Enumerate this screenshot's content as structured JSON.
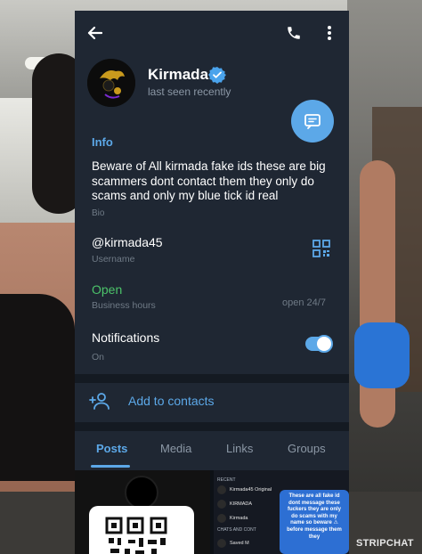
{
  "profile": {
    "name": "Kirmada",
    "status": "last seen recently"
  },
  "info": {
    "section_title": "Info",
    "bio_text": "Beware of All kirmada fake ids these are big scammers dont contact them they only do scams and only my blue tick id real",
    "bio_label": "Bio",
    "username": "@kirmada45",
    "username_label": "Username",
    "business_status": "Open",
    "business_label": "Business hours",
    "business_hours": "open 24/7",
    "notifications_title": "Notifications",
    "notifications_state": "On"
  },
  "actions": {
    "add_contact": "Add to contacts"
  },
  "tabs": [
    {
      "label": "Posts",
      "active": true
    },
    {
      "label": "Media",
      "active": false
    },
    {
      "label": "Links",
      "active": false
    },
    {
      "label": "Groups",
      "active": false
    }
  ],
  "post_preview": {
    "header": "RECENT",
    "rows": [
      "Kirmada45 Original",
      "KIRMADA",
      "Kirmada"
    ],
    "section": "CHATS AND CONT",
    "saved": "Saved M",
    "bubble_text": "These are all fake id dont message these fuckers they are only do scams with my name so beware ⚠ before message them they"
  },
  "watermark": "STRIPCHAT",
  "colors": {
    "panel_bg": "#1f2733",
    "accent": "#5ca8e8",
    "open_green": "#4cc46a"
  },
  "icons": {
    "back": "arrow-left-icon",
    "call": "phone-icon",
    "more": "more-vertical-icon",
    "verified": "verified-badge-icon",
    "message": "message-icon",
    "qr": "qr-code-icon",
    "add_contact": "add-person-icon"
  }
}
